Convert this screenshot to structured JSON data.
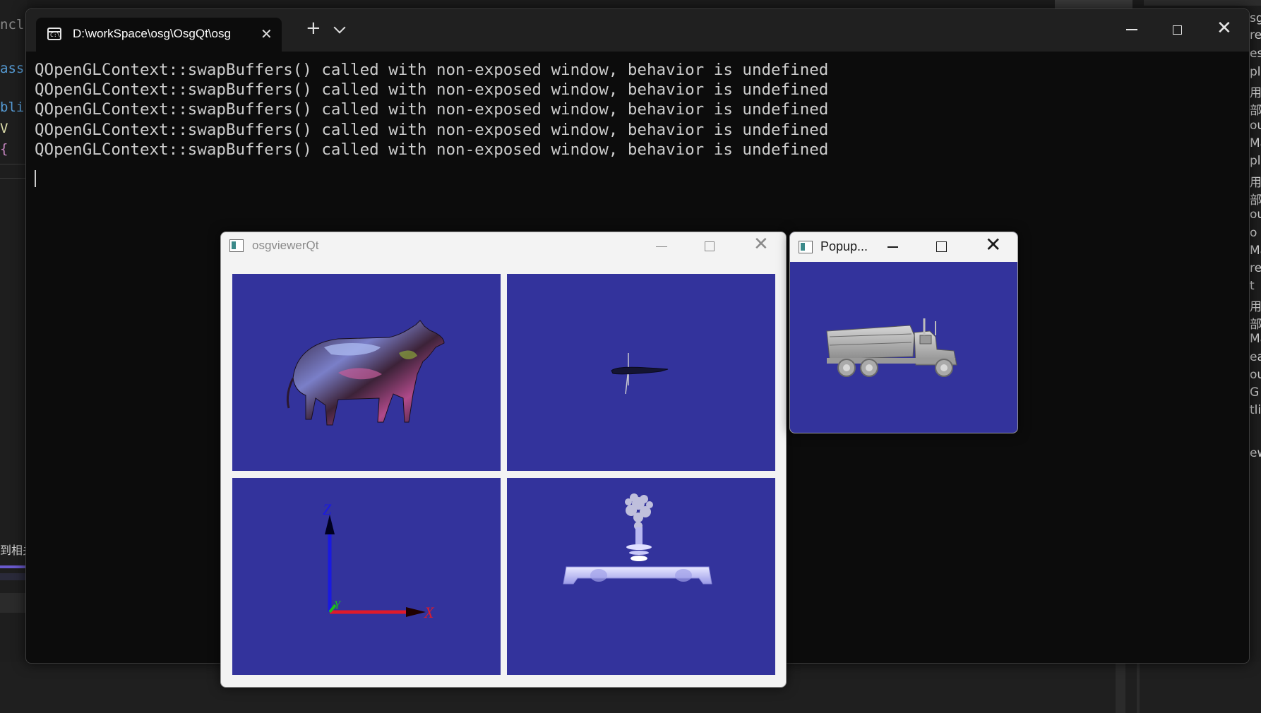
{
  "ide_left": {
    "code_lines": [
      {
        "text": "nclu",
        "color": "#8a8a8a"
      },
      {
        "text": "ass",
        "color": "#569cd6"
      },
      {
        "text": "bli",
        "color": "#569cd6"
      },
      {
        "text": " V",
        "color": "#dcdcaa"
      },
      {
        "text": " {",
        "color": "#c586c0"
      }
    ],
    "status_text": "到相关"
  },
  "ide_right": {
    "lines": [
      "sgQ",
      "re",
      "es",
      "pl",
      "用",
      "部",
      "ou",
      "Ma",
      "pl",
      "用",
      "部",
      "ou",
      "o",
      "Ma",
      "re",
      "t",
      "用",
      "部",
      "Ma",
      "ea",
      "ou",
      "G",
      "tli",
      "ew"
    ]
  },
  "terminal": {
    "tab_title": "D:\\workSpace\\osg\\OsgQt\\osg",
    "icon": "terminal-icon",
    "output_lines": [
      "QOpenGLContext::swapBuffers() called with non-exposed window, behavior is undefined",
      "QOpenGLContext::swapBuffers() called with non-exposed window, behavior is undefined",
      "QOpenGLContext::swapBuffers() called with non-exposed window, behavior is undefined",
      "QOpenGLContext::swapBuffers() called with non-exposed window, behavior is undefined",
      "QOpenGLContext::swapBuffers() called with non-exposed window, behavior is undefined"
    ]
  },
  "osg_window": {
    "title": "osgviewerQt",
    "viewports": [
      {
        "name": "cow-model"
      },
      {
        "name": "glider-model"
      },
      {
        "name": "axes-model",
        "labels": {
          "z": "Z",
          "y": "Y",
          "x": "X"
        }
      },
      {
        "name": "fountain-model"
      }
    ],
    "viewport_bg": "#33339c"
  },
  "popup_window": {
    "title": "Popup...",
    "scene": "dumptruck-model"
  }
}
